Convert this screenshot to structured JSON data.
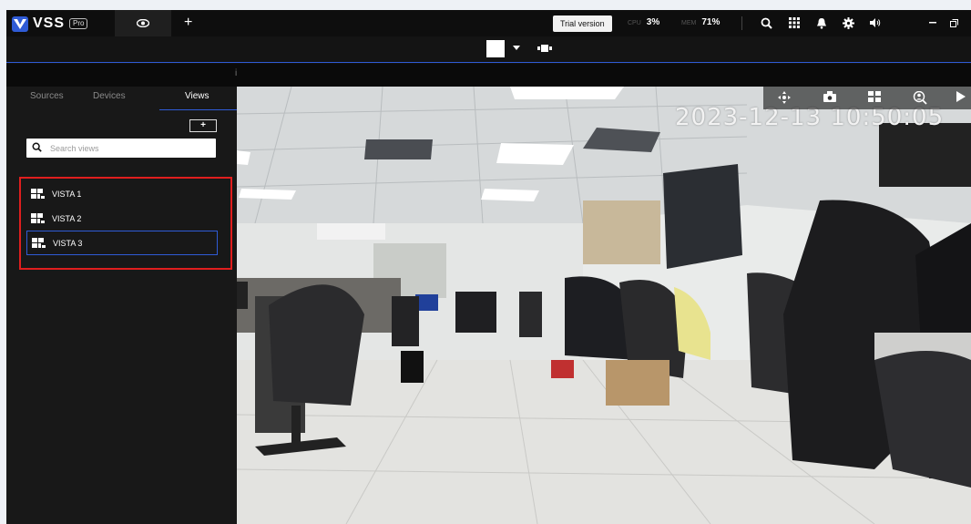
{
  "app": {
    "logo_text": "VSS",
    "logo_badge": "Pro"
  },
  "topbar": {
    "trial_label": "Trial version",
    "cpu_label": "CPU",
    "cpu_value": "3%",
    "mem_label": "MEM",
    "mem_value": "71%",
    "plus_tab": "+"
  },
  "sidebar": {
    "tabs": [
      {
        "label": "Sources"
      },
      {
        "label": "Devices"
      },
      {
        "label": "Views"
      }
    ],
    "add_label": "+",
    "search_placeholder": "Search views",
    "views": [
      {
        "label": "VISTA 1"
      },
      {
        "label": "VISTA 2"
      },
      {
        "label": "VISTA 3"
      }
    ]
  },
  "camera": {
    "timestamp": "2023-12-13 10:50:05"
  },
  "strip": {
    "mark": "i"
  },
  "colors": {
    "accent": "#2f5bd6",
    "highlight_border": "#e01e1e",
    "sidebar_bg": "#181818"
  },
  "icons": [
    "logo-v-icon",
    "eye-icon",
    "search-icon",
    "grid-icon",
    "bell-icon",
    "settings-gear-icon",
    "volume-icon",
    "minimize-icon",
    "restore-icon",
    "layout-caret-icon",
    "sequence-icon",
    "move-icon",
    "snapshot-icon",
    "layout-grid-icon",
    "search-person-icon",
    "play-icon",
    "view-layout-icon"
  ]
}
